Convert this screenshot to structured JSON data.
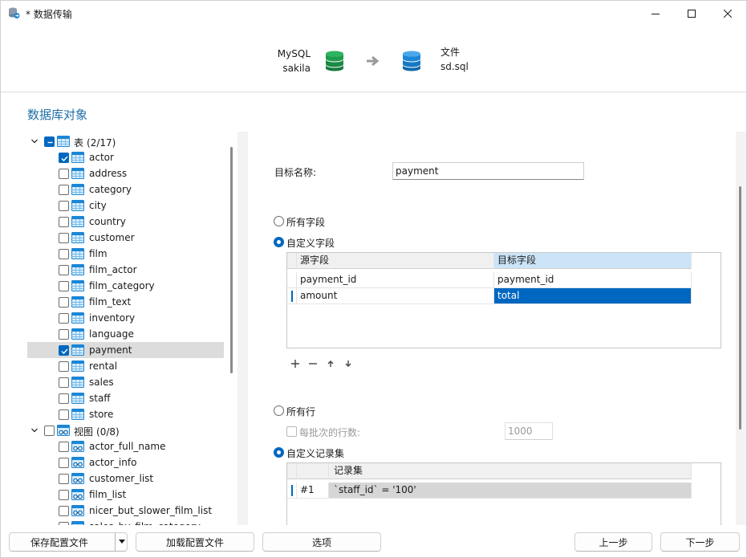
{
  "window": {
    "title": "* 数据传输"
  },
  "transfer": {
    "source_type": "MySQL",
    "source_name": "sakila",
    "target_type": "文件",
    "target_name": "sd.sql"
  },
  "section_title": "数据库对象",
  "tree": {
    "tables_label": "表",
    "tables_count": "(2/17)",
    "tables": [
      {
        "name": "actor",
        "checked": true
      },
      {
        "name": "address",
        "checked": false
      },
      {
        "name": "category",
        "checked": false
      },
      {
        "name": "city",
        "checked": false
      },
      {
        "name": "country",
        "checked": false
      },
      {
        "name": "customer",
        "checked": false
      },
      {
        "name": "film",
        "checked": false
      },
      {
        "name": "film_actor",
        "checked": false
      },
      {
        "name": "film_category",
        "checked": false
      },
      {
        "name": "film_text",
        "checked": false
      },
      {
        "name": "inventory",
        "checked": false
      },
      {
        "name": "language",
        "checked": false
      },
      {
        "name": "payment",
        "checked": true,
        "selected": true
      },
      {
        "name": "rental",
        "checked": false
      },
      {
        "name": "sales",
        "checked": false
      },
      {
        "name": "staff",
        "checked": false
      },
      {
        "name": "store",
        "checked": false
      }
    ],
    "views_label": "视图",
    "views_count": "(0/8)",
    "views": [
      {
        "name": "actor_full_name"
      },
      {
        "name": "actor_info"
      },
      {
        "name": "customer_list"
      },
      {
        "name": "film_list"
      },
      {
        "name": "nicer_but_slower_film_list"
      },
      {
        "name": "sales_by_film_category"
      }
    ]
  },
  "form": {
    "target_name_label": "目标名称:",
    "target_name_value": "payment",
    "all_fields_label": "所有字段",
    "custom_fields_label": "自定义字段",
    "fields_grid": {
      "headers": [
        "源字段",
        "目标字段"
      ],
      "rows": [
        [
          "payment_id",
          "payment_id"
        ],
        [
          "amount",
          "total"
        ]
      ]
    },
    "all_rows_label": "所有行",
    "rows_per_batch_label": "每批次的行数:",
    "rows_per_batch_value": "1000",
    "custom_recordset_label": "自定义记录集",
    "recordset_grid": {
      "header": "记录集",
      "rows": [
        {
          "index": "#1",
          "value": "`staff_id` = '100'"
        }
      ]
    }
  },
  "buttons": {
    "save_profile": "保存配置文件",
    "load_profile": "加载配置文件",
    "options": "选项",
    "back": "上一步",
    "next": "下一步"
  },
  "colors": {
    "accent": "#0067c0",
    "section_title": "#1f6fa8",
    "db_green": "#1e9b4d",
    "db_blue": "#1b86d6"
  }
}
